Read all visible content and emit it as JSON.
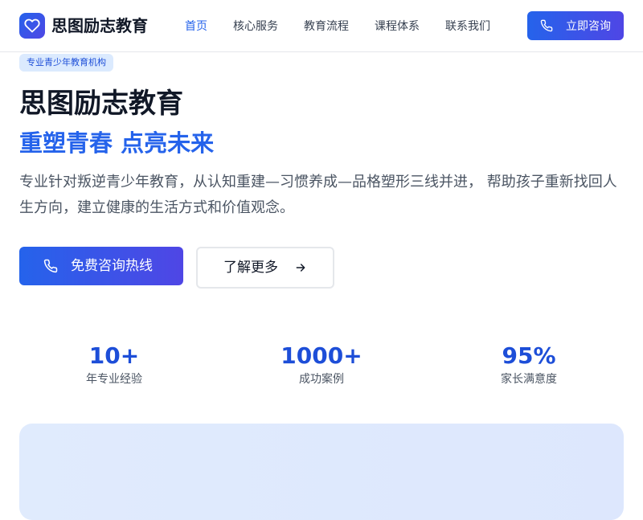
{
  "brand": {
    "name": "思图励志教育",
    "logo_icon": "heart-icon",
    "accent": "#2563eb",
    "accent_end": "#4f46e5"
  },
  "nav": {
    "items": [
      {
        "label": "首页",
        "active": true
      },
      {
        "label": "核心服务",
        "active": false
      },
      {
        "label": "教育流程",
        "active": false
      },
      {
        "label": "课程体系",
        "active": false
      },
      {
        "label": "联系我们",
        "active": false
      }
    ],
    "cta_label": "立即咨询",
    "cta_icon": "phone-icon"
  },
  "hero": {
    "tag": "专业青少年教育机构",
    "title": "思图励志教育",
    "subtitle": "重塑青春 点亮未来",
    "description": "专业针对叛逆青少年教育，从认知重建—习惯养成—品格塑形三线并进， 帮助孩子重新找回人生方向，建立健康的生活方式和价值观念。",
    "primary_button": "免费咨询热线",
    "primary_icon": "phone-icon",
    "secondary_button": "了解更多",
    "secondary_icon": "arrow-right-icon"
  },
  "stats": [
    {
      "value": "10+",
      "label": "年专业经验"
    },
    {
      "value": "1000+",
      "label": "成功案例"
    },
    {
      "value": "95%",
      "label": "家长满意度"
    }
  ]
}
